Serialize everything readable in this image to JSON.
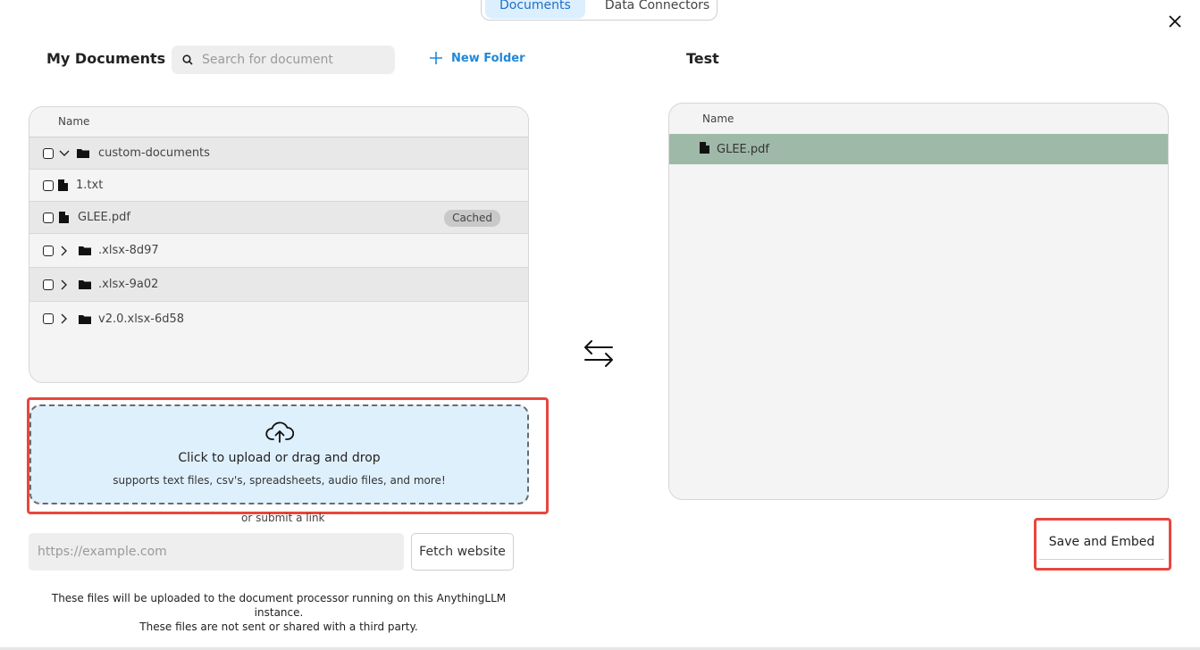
{
  "tabs": [
    {
      "label": "Documents",
      "active": true
    },
    {
      "label": "Data Connectors",
      "active": false
    }
  ],
  "left": {
    "title": "My Documents",
    "search_placeholder": "Search for document",
    "new_folder_label": "New Folder",
    "table_header": "Name",
    "rows": [
      {
        "name": "custom-documents",
        "type": "folder",
        "expanded": true
      },
      {
        "name": "1.txt",
        "type": "file"
      },
      {
        "name": "GLEE.pdf",
        "type": "file",
        "badge": "Cached"
      },
      {
        "name": ".xlsx-8d97",
        "type": "folder",
        "expanded": false
      },
      {
        "name": ".xlsx-9a02",
        "type": "folder",
        "expanded": false
      },
      {
        "name": "v2.0.xlsx-6d58",
        "type": "folder",
        "expanded": false
      }
    ]
  },
  "upload": {
    "title": "Click to upload or drag and drop",
    "subtitle": "supports text files, csv's, spreadsheets, audio files, and more!",
    "or_link": "or submit a link",
    "url_placeholder": "https://example.com",
    "fetch_label": "Fetch website",
    "disclaimer_line1": "These files will be uploaded to the document processor running on this AnythingLLM instance.",
    "disclaimer_line2": "These files are not sent or shared with a third party."
  },
  "right": {
    "title": "Test",
    "table_header": "Name",
    "rows": [
      {
        "name": "GLEE.pdf",
        "type": "file"
      }
    ],
    "save_label": "Save and Embed"
  },
  "colors": {
    "active_tab_bg": "#dcefff",
    "accent_blue": "#1f88d8",
    "upload_bg": "#dff0fd",
    "selected_row": "#9fb9a8",
    "highlight_red": "#e8463e"
  }
}
